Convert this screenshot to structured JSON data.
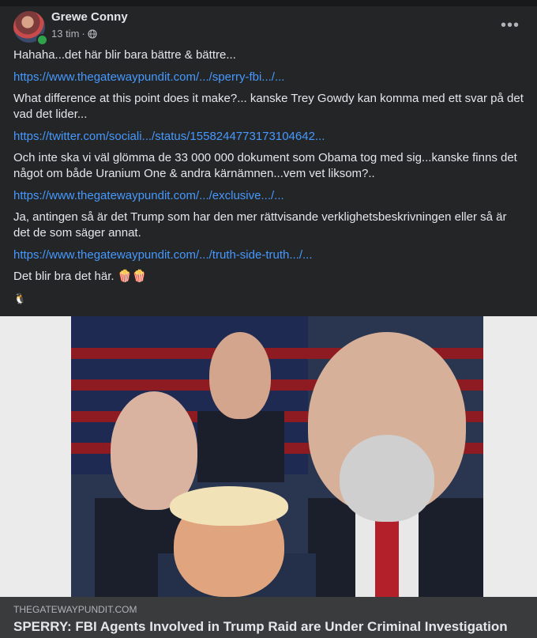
{
  "post": {
    "author": "Grewe Conny",
    "time": "13 tim",
    "meta_separator": "·",
    "more_label": "•••",
    "paragraphs": [
      {
        "type": "text",
        "text": "Hahaha...det här blir bara bättre & bättre..."
      },
      {
        "type": "link",
        "text": "https://www.thegatewaypundit.com/.../sperry-fbi.../..."
      },
      {
        "type": "text",
        "text": "What difference at this point does it make?... kanske Trey Gowdy kan komma med ett svar på det vad det lider..."
      },
      {
        "type": "link",
        "text": "https://twitter.com/sociali.../status/1558244773173104642..."
      },
      {
        "type": "text",
        "text": "Och inte ska vi väl glömma de 33 000 000 dokument som Obama tog med sig...kanske finns det något om både Uranium One & andra kärnämnen...vem vet liksom?.."
      },
      {
        "type": "link",
        "text": "https://www.thegatewaypundit.com/.../exclusive.../..."
      },
      {
        "type": "text",
        "text": "Ja, antingen så är det Trump som har den mer rättvisande verklighetsbeskrivningen eller så är det de som säger annat."
      },
      {
        "type": "link",
        "text": "https://www.thegatewaypundit.com/.../truth-side-truth.../..."
      }
    ],
    "closing": "Det blir bra det här. 🍿🍿",
    "closing_emoji": "🐧"
  },
  "link_preview": {
    "domain": "THEGATEWAYPUNDIT.COM",
    "headline": "SPERRY: FBI Agents Involved in Trump Raid are Under Criminal Investigation by Durham For Abusing Their Power in Trump-Russia Probe"
  },
  "colors": {
    "background": "#242526",
    "link": "#4599ff",
    "text": "#e4e6eb",
    "muted": "#b0b3b8",
    "online": "#31a24c"
  },
  "icons": [
    "avatar",
    "online-indicator",
    "globe-icon",
    "more-options-icon"
  ]
}
